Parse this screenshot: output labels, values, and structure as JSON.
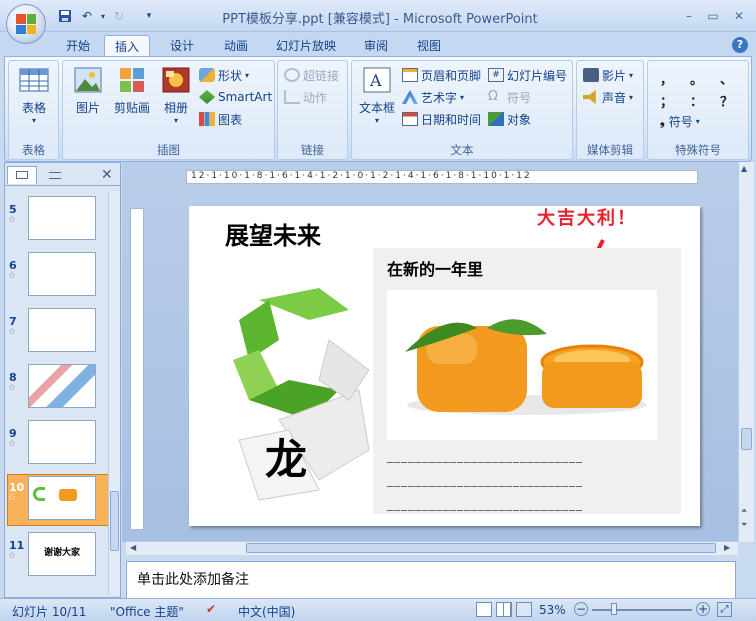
{
  "window": {
    "title": "PPT模板分享.ppt [兼容模式] - Microsoft PowerPoint"
  },
  "tabs": [
    "开始",
    "插入",
    "设计",
    "动画",
    "幻灯片放映",
    "审阅",
    "视图"
  ],
  "active_tab": "插入",
  "ribbon": {
    "groups": {
      "table": {
        "label": "表格",
        "button": "表格"
      },
      "illustrations": {
        "label": "插图",
        "picture": "图片",
        "clipart": "剪贴画",
        "album": "相册",
        "shapes": "形状",
        "smartart": "SmartArt",
        "chart": "图表"
      },
      "links": {
        "label": "链接",
        "hyperlink": "超链接",
        "action": "动作"
      },
      "text": {
        "label": "文本",
        "textbox": "文本框",
        "header_footer": "页眉和页脚",
        "wordart": "艺术字",
        "datetime": "日期和时间",
        "slide_number": "幻灯片编号",
        "symbol": "符号",
        "object": "对象"
      },
      "media": {
        "label": "媒体剪辑",
        "movie": "影片",
        "sound": "声音"
      },
      "special": {
        "label": "特殊符号",
        "chars": [
          "，",
          "。",
          "、",
          "；",
          "：",
          "？"
        ],
        "symbol": "符号"
      }
    }
  },
  "thumbnails": [
    {
      "num": "5",
      "star": "☆"
    },
    {
      "num": "6",
      "star": "☆"
    },
    {
      "num": "7",
      "star": "☆"
    },
    {
      "num": "8",
      "star": "☆"
    },
    {
      "num": "9",
      "star": "☆"
    },
    {
      "num": "10",
      "star": "☆"
    },
    {
      "num": "11",
      "star": "☆",
      "text": "谢谢大家"
    }
  ],
  "slide": {
    "title": "展望未来",
    "annotation": "大吉大利！",
    "subtitle": "在新的一年里",
    "dragon_char": "龙",
    "lines": [
      "____________________________",
      "____________________________",
      "____________________________"
    ]
  },
  "notes_placeholder": "单击此处添加备注",
  "status": {
    "slide_info": "幻灯片 10/11",
    "theme": "\"Office 主题\"",
    "language": "中文(中国)",
    "zoom": "53%"
  },
  "ruler": "12·1·10·1·8·1·6·1·4·1·2·1·0·1·2·1·4·1·6·1·8·1·10·1·12"
}
